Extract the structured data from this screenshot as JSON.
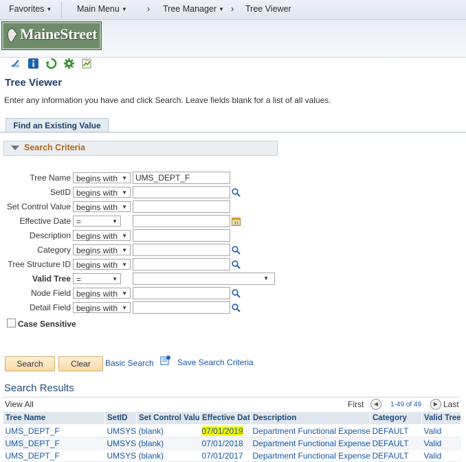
{
  "nav": {
    "favorites": "Favorites",
    "main_menu": "Main Menu",
    "tree_manager": "Tree Manager",
    "tree_viewer": "Tree Viewer"
  },
  "logo": {
    "text": "MaineStreet"
  },
  "page": {
    "title": "Tree Viewer",
    "instructions": "Enter any information you have and click Search. Leave fields blank for a list of all values.",
    "tab": "Find an Existing Value",
    "criteria_header": "Search Criteria"
  },
  "fields": [
    {
      "label": "Tree Name",
      "operator": "begins with",
      "value": "UMS_DEPT_F"
    },
    {
      "label": "SetID",
      "operator": "begins with",
      "value": ""
    },
    {
      "label": "Set Control Value",
      "operator": "begins with",
      "value": ""
    },
    {
      "label": "Effective Date",
      "operator": "=",
      "value": ""
    },
    {
      "label": "Description",
      "operator": "begins with",
      "value": ""
    },
    {
      "label": "Category",
      "operator": "begins with",
      "value": ""
    },
    {
      "label": "Tree Structure ID",
      "operator": "begins with",
      "value": ""
    },
    {
      "label": "Valid Tree",
      "operator": "=",
      "value": ""
    },
    {
      "label": "Node Field",
      "operator": "begins with",
      "value": ""
    },
    {
      "label": "Detail Field",
      "operator": "begins with",
      "value": ""
    }
  ],
  "case_sensitive": {
    "label": "Case Sensitive",
    "checked": false
  },
  "buttons": {
    "search": "Search",
    "clear": "Clear",
    "basic_search": "Basic Search",
    "save_search": "Save Search Criteria"
  },
  "results": {
    "title": "Search Results",
    "view_all": "View All",
    "first": "First",
    "range": "1-49 of 49",
    "last": "Last",
    "columns": [
      "Tree Name",
      "SetID",
      "Set Control Value",
      "Effective Date",
      "Description",
      "Category",
      "Valid Tree"
    ],
    "rows": [
      [
        "UMS_DEPT_F",
        "UMSYS",
        "(blank)",
        "07/01/2019",
        "Department Functional Expense",
        "DEFAULT",
        "Valid"
      ],
      [
        "UMS_DEPT_F",
        "UMSYS",
        "(blank)",
        "07/01/2018",
        "Department Functional Expense",
        "DEFAULT",
        "Valid"
      ],
      [
        "UMS_DEPT_F",
        "UMSYS",
        "(blank)",
        "07/01/2017",
        "Department Functional Expense",
        "DEFAULT",
        "Valid"
      ]
    ]
  },
  "colors": {
    "accent": "#1657a6",
    "title": "#1f3f6a",
    "criteria": "#b3661d",
    "highlight": "#f7f700"
  }
}
